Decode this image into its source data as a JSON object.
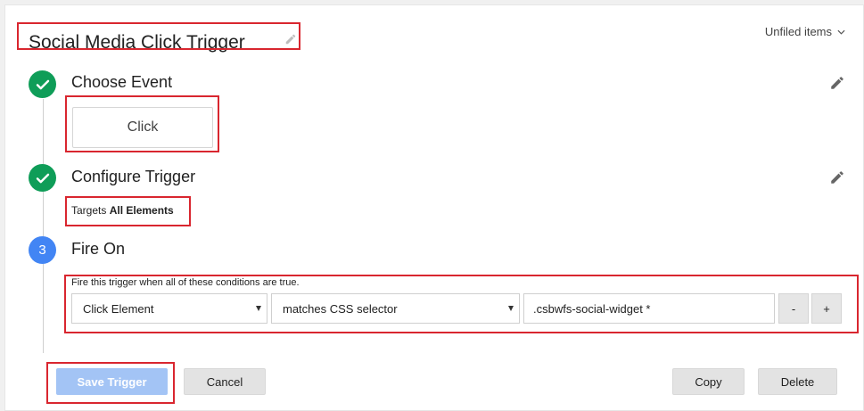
{
  "header": {
    "title": "Social Media Click Trigger",
    "folder_label": "Unfiled items"
  },
  "steps": [
    {
      "status": "done",
      "title": "Choose Event"
    },
    {
      "status": "done",
      "title": "Configure Trigger"
    },
    {
      "status": "current",
      "number": "3",
      "title": "Fire On"
    }
  ],
  "event": {
    "selected": "Click"
  },
  "configure": {
    "targets_prefix": "Targets",
    "targets_value": "All Elements"
  },
  "fire_on": {
    "condition_label": "Fire this trigger when all of these conditions are true.",
    "variable": "Click Element",
    "operator": "matches CSS selector",
    "value": ".csbwfs-social-widget *",
    "remove_label": "-",
    "add_label": "+"
  },
  "actions": {
    "save": "Save Trigger",
    "cancel": "Cancel",
    "copy": "Copy",
    "delete": "Delete"
  },
  "colors": {
    "done": "#0f9d58",
    "current": "#4285f4",
    "primary_disabled": "#a3c4f5",
    "highlight": "#d9262f"
  },
  "icons": [
    "pencil-icon",
    "chevron-down-icon",
    "checkmark-icon"
  ]
}
